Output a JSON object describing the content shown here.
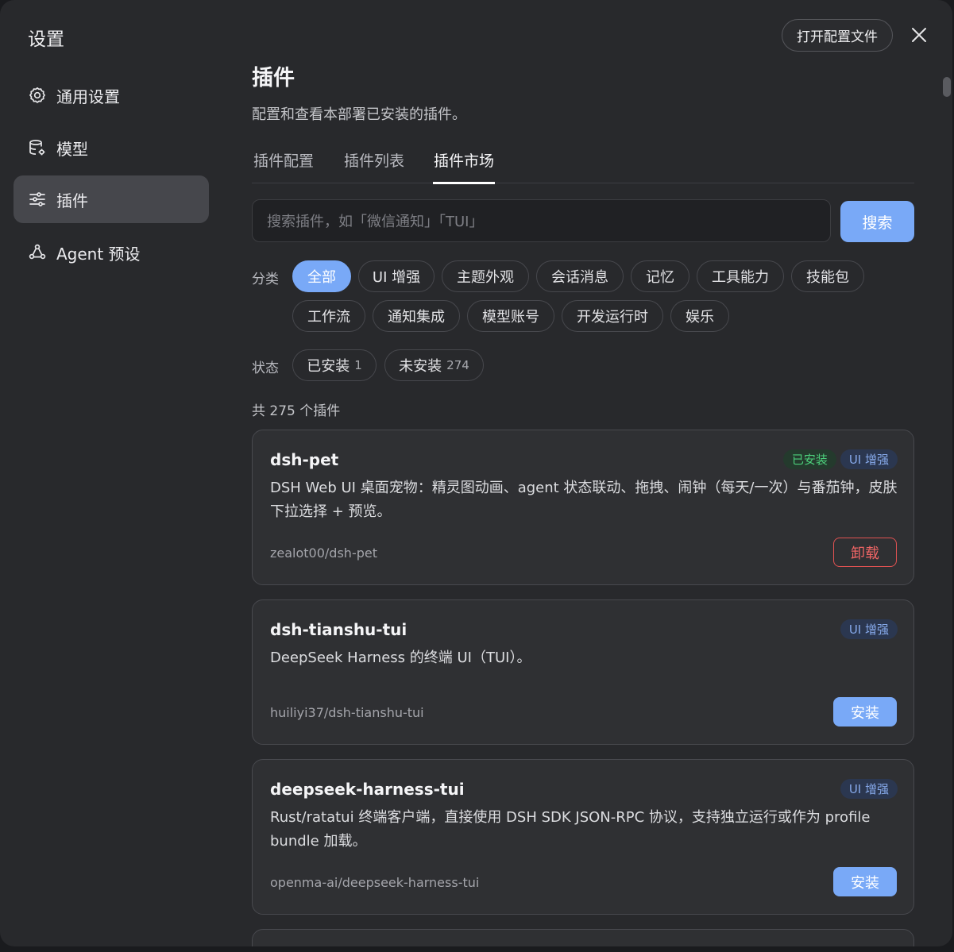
{
  "app_title": "设置",
  "header": {
    "open_config_label": "打开配置文件"
  },
  "sidebar": {
    "items": [
      {
        "label": "通用设置",
        "icon": "gear-icon"
      },
      {
        "label": "模型",
        "icon": "database-gear-icon"
      },
      {
        "label": "插件",
        "icon": "sliders-icon",
        "active": true
      },
      {
        "label": "Agent 预设",
        "icon": "agent-nodes-icon"
      }
    ]
  },
  "main": {
    "title": "插件",
    "subtitle": "配置和查看本部署已安装的插件。",
    "tabs": [
      {
        "label": "插件配置"
      },
      {
        "label": "插件列表"
      },
      {
        "label": "插件市场",
        "active": true
      }
    ],
    "search": {
      "placeholder": "搜索插件，如「微信通知」「TUI」",
      "button_label": "搜索"
    },
    "category_label": "分类",
    "categories": [
      "全部",
      "UI 增强",
      "主题外观",
      "会话消息",
      "记忆",
      "工具能力",
      "技能包",
      "工作流",
      "通知集成",
      "模型账号",
      "开发运行时",
      "娱乐"
    ],
    "selected_category": "全部",
    "status_label": "状态",
    "statuses": [
      {
        "label": "已安装",
        "count": "1"
      },
      {
        "label": "未安装",
        "count": "274"
      }
    ],
    "total_text": "共 275 个插件",
    "plugins": [
      {
        "name": "dsh-pet",
        "installed_badge": "已安装",
        "tag": "UI 增强",
        "description": "DSH Web UI 桌面宠物：精灵图动画、agent 状态联动、拖拽、闹钟（每天/一次）与番茄钟，皮肤下拉选择 + 预览。",
        "repo": "zealot00/dsh-pet",
        "action": "卸载"
      },
      {
        "name": "dsh-tianshu-tui",
        "tag": "UI 增强",
        "description": "DeepSeek Harness 的终端 UI（TUI）。",
        "repo": "huiliyi37/dsh-tianshu-tui",
        "action": "安装"
      },
      {
        "name": "deepseek-harness-tui",
        "tag": "UI 增强",
        "description": "Rust/ratatui 终端客户端，直接使用 DSH SDK JSON-RPC 协议，支持独立运行或作为 profile bundle 加载。",
        "repo": "openma-ai/deepseek-harness-tui",
        "action": "安装"
      }
    ]
  },
  "colors": {
    "accent": "#79a9f7",
    "danger": "#e05252",
    "success": "#4ccf7b"
  }
}
